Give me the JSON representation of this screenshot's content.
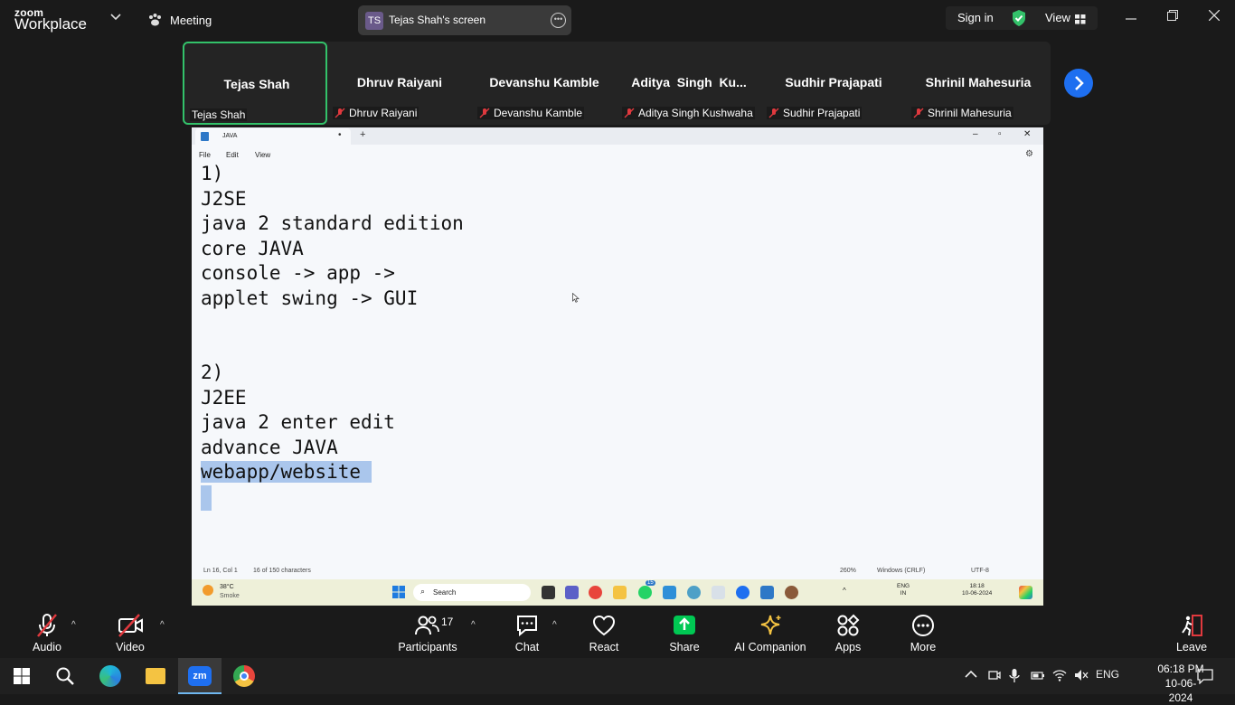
{
  "top": {
    "brand_small": "zoom",
    "brand_big": "Workplace",
    "meeting_label": "Meeting",
    "share_badge": "TS",
    "share_title": "Tejas Shah's screen",
    "signin": "Sign in",
    "view": "View"
  },
  "participants_strip": [
    {
      "name": "Tejas Shah",
      "label": "Tejas Shah",
      "muted": false,
      "active": true
    },
    {
      "name": "Dhruv Raiyani",
      "label": "Dhruv Raiyani",
      "muted": true,
      "active": false
    },
    {
      "name": "Devanshu Kamble",
      "label": "Devanshu Kamble",
      "muted": true,
      "active": false
    },
    {
      "name": "Aditya  Singh  Ku...",
      "label": "Aditya Singh Kushwaha",
      "muted": true,
      "active": false
    },
    {
      "name": "Sudhir Prajapati",
      "label": "Sudhir Prajapati",
      "muted": true,
      "active": false
    },
    {
      "name": "Shrinil Mahesuria",
      "label": "Shrinil Mahesuria",
      "muted": true,
      "active": false
    }
  ],
  "notepad": {
    "tab_title": "JAVA",
    "menus": [
      "File",
      "Edit",
      "View"
    ],
    "lines": [
      "1)",
      "J2SE",
      "java 2 standard edition",
      "core JAVA",
      "console -> app ->",
      "applet swing -> GUI",
      "",
      "",
      "2)",
      "J2EE",
      "java 2 enter edit",
      "advance JAVA",
      "webapp/website"
    ],
    "status": {
      "position": "Ln 16, Col 1",
      "chars": "16 of 150 characters",
      "zoom": "260%",
      "line_ending": "Windows (CRLF)",
      "encoding": "UTF-8"
    },
    "taskbar": {
      "weather_temp": "38°C",
      "weather_desc": "Smoke",
      "search": "Search",
      "lang1": "ENG",
      "lang2": "IN",
      "time": "18:18",
      "date": "10-06-2024",
      "badge": "15"
    }
  },
  "toolbar": {
    "audio": "Audio",
    "video": "Video",
    "participants": "Participants",
    "participants_count": "17",
    "chat": "Chat",
    "react": "React",
    "share": "Share",
    "ai": "AI Companion",
    "apps": "Apps",
    "more": "More",
    "leave": "Leave"
  },
  "windows": {
    "lang": "ENG",
    "time": "06:18 PM",
    "date": "10-06-2024"
  },
  "colors": {
    "accent_green": "#33c26a",
    "zoom_blue": "#1e6ff0",
    "share_green": "#00c853",
    "muted_red": "#e0393e"
  }
}
